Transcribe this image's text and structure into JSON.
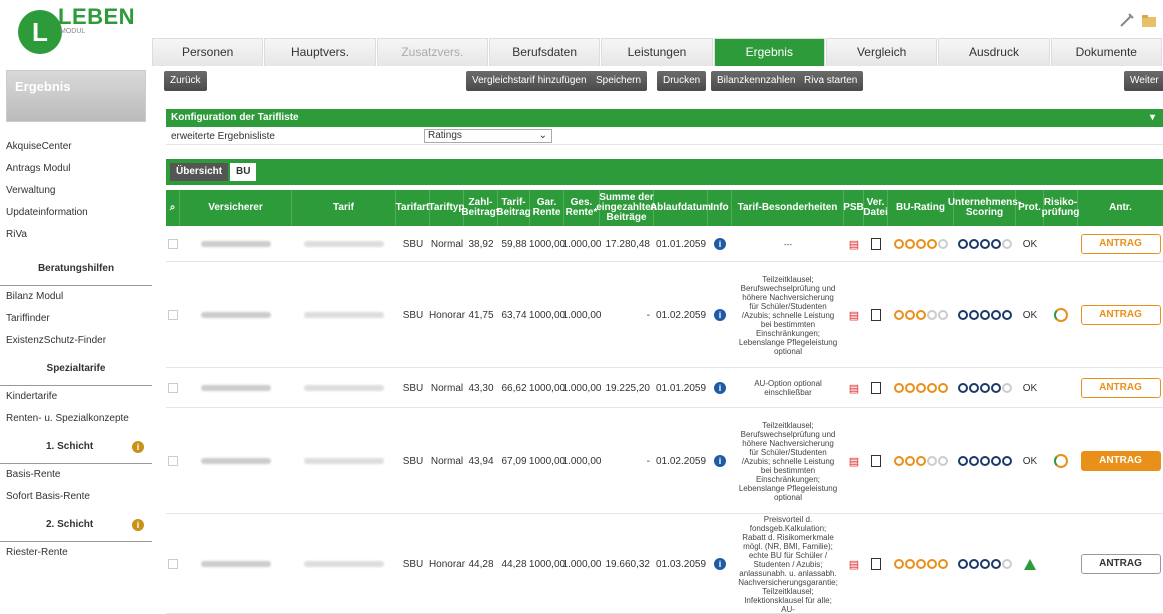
{
  "logo": {
    "word": "LEBEN",
    "sub": "MODUL",
    "letter": "L"
  },
  "tabs": [
    {
      "label": "Personen"
    },
    {
      "label": "Hauptvers."
    },
    {
      "label": "Zusatzvers."
    },
    {
      "label": "Berufsdaten"
    },
    {
      "label": "Leistungen"
    },
    {
      "label": "Ergebnis"
    },
    {
      "label": "Vergleich"
    },
    {
      "label": "Ausdruck"
    },
    {
      "label": "Dokumente"
    }
  ],
  "sidebar": {
    "title": "Ergebnis",
    "items": [
      "AkquiseCenter",
      "Antrags Modul",
      "Verwaltung",
      "Updateinformation",
      "RiVa"
    ],
    "sec1": "Beratungshilfen",
    "items2": [
      "Bilanz Modul",
      "Tariffinder",
      "ExistenzSchutz-Finder"
    ],
    "sec2": "Spezialtarife",
    "items3": [
      "Kindertarife",
      "Renten- u. Spezialkonzepte"
    ],
    "sec3": "1. Schicht",
    "items4": [
      "Basis-Rente",
      "Sofort Basis-Rente"
    ],
    "sec4": "2. Schicht",
    "items5": [
      "Riester-Rente"
    ]
  },
  "toolbar": {
    "back": "Zurück",
    "add": "Vergleichstarif hinzufügen",
    "save": "Speichern",
    "print": "Drucken",
    "bilanz": "Bilanzkennzahlen",
    "riva": "Riva starten",
    "next": "Weiter"
  },
  "config": {
    "title": "Konfiguration der Tarifliste",
    "label": "erweiterte Ergebnisliste",
    "select": "Ratings"
  },
  "subtabs": {
    "overview": "Übersicht",
    "bu": "BU"
  },
  "headers": {
    "versicherer": "Versicherer",
    "tarif": "Tarif",
    "tarifart": "Tarifart",
    "tariftyp": "Tariftyp",
    "zahl": "Zahl-Beitrag*",
    "tarifb": "Tarif-Beitrag",
    "gar": "Gar. Rente",
    "ges": "Ges. Rente*",
    "summe": "Summe der eingezahlten Beiträge",
    "ablauf": "Ablaufdatum",
    "info": "Info",
    "besond": "Tarif-Besonderheiten",
    "psb": "PSB",
    "ver": "Ver. Datei",
    "bu": "BU-Rating",
    "unt": "Unternehmens-Scoring",
    "prot": "Prot.",
    "risiko": "Risiko-prüfung",
    "antr": "Antr."
  },
  "rows": [
    {
      "art": "SBU",
      "typ": "Normal",
      "zahl": "38,92",
      "tarif": "59,88",
      "gar": "1000,00",
      "ges": "1.000,00",
      "summe": "17.280,48",
      "ablauf": "01.01.2059",
      "besond": "---",
      "bu": 4,
      "unt": 4,
      "prot": "OK",
      "antr": "ANTRAG"
    },
    {
      "art": "SBU",
      "typ": "Honorar",
      "zahl": "41,75",
      "tarif": "63,74",
      "gar": "1000,00",
      "ges": "1.000,00",
      "summe": "-",
      "ablauf": "01.02.2059",
      "besond": "Teilzeitklausel; Berufswechselprüfung und höhere Nachversicherung für Schüler/Studenten /Azubis; schnelle Leistung bei bestimmten Einschränkungen; Lebenslange Pflegeleistung optional",
      "bu": 3,
      "unt": 5,
      "prot": "OK",
      "antr": "ANTRAG"
    },
    {
      "art": "SBU",
      "typ": "Normal",
      "zahl": "43,30",
      "tarif": "66,62",
      "gar": "1000,00",
      "ges": "1.000,00",
      "summe": "19.225,20",
      "ablauf": "01.01.2059",
      "besond": "AU-Option optional einschließbar",
      "bu": 5,
      "unt": 4,
      "prot": "OK",
      "antr": "ANTRAG"
    },
    {
      "art": "SBU",
      "typ": "Normal",
      "zahl": "43,94",
      "tarif": "67,09",
      "gar": "1000,00",
      "ges": "1.000,00",
      "summe": "-",
      "ablauf": "01.02.2059",
      "besond": "Teilzeitklausel; Berufswechselprüfung und höhere Nachversicherung für Schüler/Studenten /Azubis; schnelle Leistung bei bestimmten Einschränkungen; Lebenslange Pflegeleistung optional",
      "bu": 3,
      "unt": 5,
      "prot": "OK",
      "antr": "ANTRAG"
    },
    {
      "art": "SBU",
      "typ": "Honorar",
      "zahl": "44,28",
      "tarif": "44,28",
      "gar": "1000,00",
      "ges": "1.000,00",
      "summe": "19.660,32",
      "ablauf": "01.03.2059",
      "besond": "Preisvorteil d. fondsgeb.Kalkulation; Rabatt d. Risikomerkmale mögl. (NR, BMI, Familie); echte BU für Schüler / Studenten / Azubis; anlassunabh. u. anlassabh. Nachversicherungsgarantie; Teilzeitklausel; Infektionsklausel für alle; AU-",
      "bu": 5,
      "unt": 4,
      "prot": "",
      "antr": "ANTRAG"
    }
  ]
}
